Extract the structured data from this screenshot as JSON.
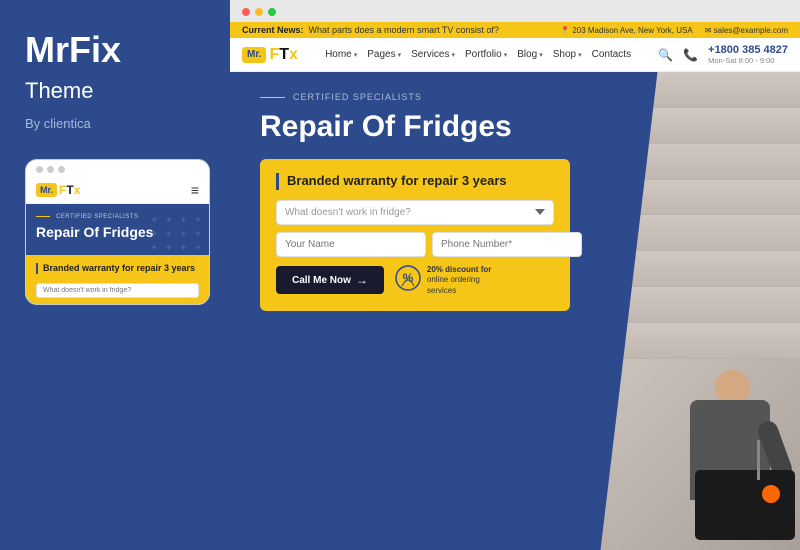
{
  "left_panel": {
    "brand_name": "MrFix",
    "brand_subtitle": "Theme",
    "brand_by": "By clientica"
  },
  "mobile_mockup": {
    "logo_box": "Mr.",
    "logo_text": "F",
    "logo_t": "T",
    "logo_x": "x",
    "certified": "CERTIFIED SPECIALISTS",
    "hero_title": "Repair Of Fridges",
    "card_title": "Branded warranty for repair 3 years",
    "input_placeholder": "What doesn't work in fridge?"
  },
  "browser": {
    "dots": [
      "red",
      "yellow",
      "green"
    ]
  },
  "info_bar": {
    "news_label": "Current News:",
    "news_text": "What parts does a modern smart TV consist of?",
    "location": "203 Madison Ave, New York, USA",
    "email": "sales@example.com"
  },
  "nav": {
    "logo_box": "Mr.",
    "logo_text_f": "F",
    "logo_text_tx": "Tx",
    "links": [
      {
        "label": "Home"
      },
      {
        "label": "Pages"
      },
      {
        "label": "Services"
      },
      {
        "label": "Portfolio"
      },
      {
        "label": "Blog"
      },
      {
        "label": "Shop"
      },
      {
        "label": "Contacts"
      }
    ],
    "phone": "+1800 385 4827",
    "hours": "Mon-Sat 8:00 - 9:00"
  },
  "hero": {
    "certified_label": "CERTIFIED SPECIALISTS",
    "title": "Repair Of Fridges",
    "form": {
      "card_title": "Branded warranty for repair 3 years",
      "select_placeholder": "What doesn't work in fridge?",
      "name_placeholder": "Your Name",
      "phone_placeholder": "Phone Number*",
      "btn_label": "Call Me Now",
      "discount_line1": "20% discount for",
      "discount_line2": "online ordering",
      "discount_line3": "services"
    }
  }
}
